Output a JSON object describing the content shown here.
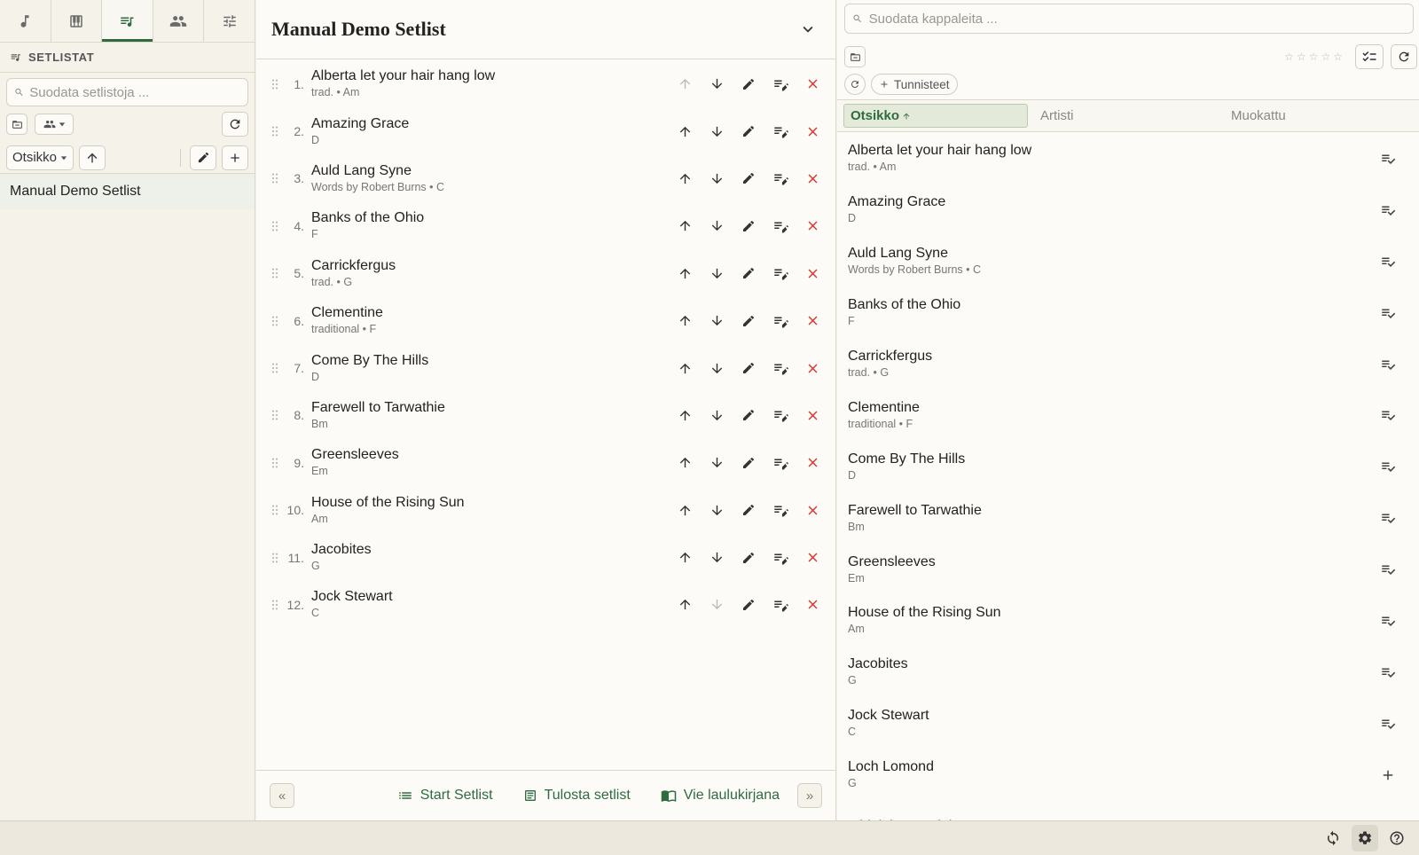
{
  "left": {
    "section_title": "SETLISTAT",
    "filter_placeholder": "Suodata setlistoja ...",
    "sort_label": "Otsikko",
    "setlists": [
      "Manual Demo Setlist"
    ]
  },
  "center": {
    "title": "Manual Demo Setlist",
    "songs": [
      {
        "num": "1.",
        "title": "Alberta let your hair hang low",
        "sub": "trad. • Am"
      },
      {
        "num": "2.",
        "title": "Amazing Grace",
        "sub": "D"
      },
      {
        "num": "3.",
        "title": "Auld Lang Syne",
        "sub": "Words by Robert Burns • C"
      },
      {
        "num": "4.",
        "title": "Banks of the Ohio",
        "sub": "F"
      },
      {
        "num": "5.",
        "title": "Carrickfergus",
        "sub": "trad. • G"
      },
      {
        "num": "6.",
        "title": "Clementine",
        "sub": "traditional • F"
      },
      {
        "num": "7.",
        "title": "Come By The Hills",
        "sub": "D"
      },
      {
        "num": "8.",
        "title": "Farewell to Tarwathie",
        "sub": "Bm"
      },
      {
        "num": "9.",
        "title": "Greensleeves",
        "sub": "Em"
      },
      {
        "num": "10.",
        "title": "House of the Rising Sun",
        "sub": "Am"
      },
      {
        "num": "11.",
        "title": "Jacobites",
        "sub": "G"
      },
      {
        "num": "12.",
        "title": "Jock Stewart",
        "sub": "C"
      }
    ],
    "footer": {
      "prev": "«",
      "next": "»",
      "start": "Start Setlist",
      "print": "Tulosta setlist",
      "export": "Vie laulukirjana"
    }
  },
  "right": {
    "search_placeholder": "Suodata kappaleita ...",
    "tags_label": "Tunnisteet",
    "columns": {
      "title": "Otsikko",
      "artist": "Artisti",
      "modified": "Muokattu"
    },
    "songs": [
      {
        "title": "Alberta let your hair hang low",
        "sub": "trad. • Am",
        "in_setlist": true
      },
      {
        "title": "Amazing Grace",
        "sub": "D",
        "in_setlist": true
      },
      {
        "title": "Auld Lang Syne",
        "sub": "Words by Robert Burns • C",
        "in_setlist": true
      },
      {
        "title": "Banks of the Ohio",
        "sub": "F",
        "in_setlist": true
      },
      {
        "title": "Carrickfergus",
        "sub": "trad. • G",
        "in_setlist": true
      },
      {
        "title": "Clementine",
        "sub": "traditional • F",
        "in_setlist": true
      },
      {
        "title": "Come By The Hills",
        "sub": "D",
        "in_setlist": true
      },
      {
        "title": "Farewell to Tarwathie",
        "sub": "Bm",
        "in_setlist": true
      },
      {
        "title": "Greensleeves",
        "sub": "Em",
        "in_setlist": true
      },
      {
        "title": "House of the Rising Sun",
        "sub": "Am",
        "in_setlist": true
      },
      {
        "title": "Jacobites",
        "sub": "G",
        "in_setlist": true
      },
      {
        "title": "Jock Stewart",
        "sub": "C",
        "in_setlist": true
      },
      {
        "title": "Loch Lomond",
        "sub": "G",
        "in_setlist": false
      },
      {
        "title": "Midnight Special",
        "sub": "",
        "in_setlist": false
      }
    ]
  },
  "colors": {
    "accent": "#2f6b3f",
    "danger": "#d9342b",
    "background": "#f5f2ea",
    "panel": "#fcfbf7"
  }
}
